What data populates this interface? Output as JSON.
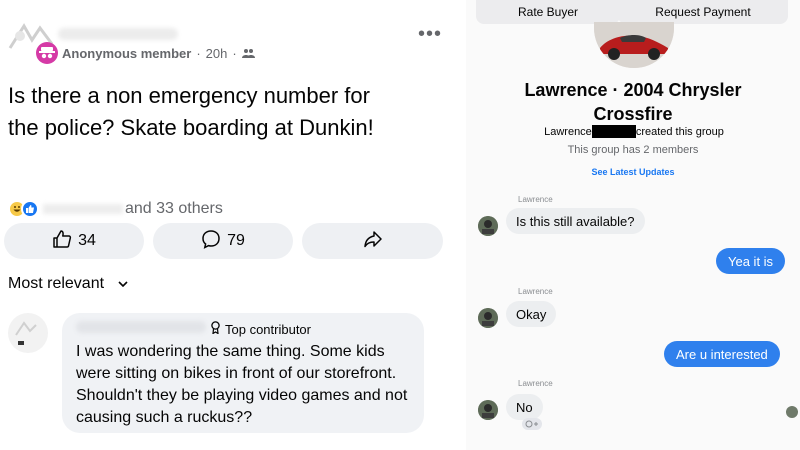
{
  "post": {
    "author": "Anonymous member",
    "time": "20h",
    "privacy_icon": "group-icon",
    "more_icon": "more-dots-icon",
    "more_glyph": "•••",
    "text": "Is there a non emergency  number for the police? Skate boarding at Dunkin!",
    "reactions_text": "and 33 others",
    "like_count": "34",
    "comment_count": "79",
    "sort_label": "Most relevant"
  },
  "comment": {
    "badge": "Top contributor",
    "text": "I was wondering the same thing. Some kids were sitting on bikes in front of our storefront. Shouldn't they be playing video games and not causing such a ruckus??"
  },
  "chat": {
    "rate_buyer": "Rate Buyer",
    "request_payment": "Request Payment",
    "group_title": "Lawrence · 2004 Chrysler Crossfire",
    "created_prefix": "Lawrence",
    "created_suffix": "created this group",
    "members_text": "This group has 2 members",
    "see_updates": "See Latest Updates",
    "messages": [
      {
        "sender": "Lawrence",
        "text": "Is this still available?",
        "direction": "in"
      },
      {
        "sender": "",
        "text": "Yea it is",
        "direction": "out"
      },
      {
        "sender": "Lawrence",
        "text": "Okay",
        "direction": "in"
      },
      {
        "sender": "",
        "text": "Are u interested",
        "direction": "out"
      },
      {
        "sender": "Lawrence",
        "text": "No",
        "direction": "in"
      }
    ]
  },
  "colors": {
    "messenger_blue": "#2f80ed",
    "facebook_blue": "#1877f2",
    "anon_badge": "#d53aa6"
  }
}
